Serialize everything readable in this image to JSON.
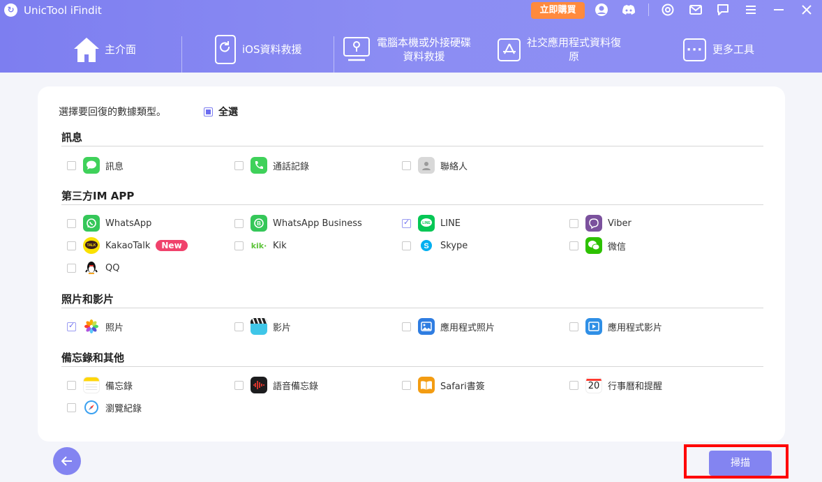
{
  "app": {
    "title": "UnicTool iFindit",
    "buy_label": "立即購買"
  },
  "titlebar_icons": [
    "user-avatar-icon",
    "discord-icon",
    "settings-icon",
    "mail-icon",
    "chat-icon",
    "menu-icon",
    "minimize-icon",
    "close-icon"
  ],
  "nav": {
    "home": "主介面",
    "ios": "iOS資料救援",
    "pc_line1": "電腦本機或外接硬碟",
    "pc_line2": "資料救援",
    "social_line1": "社交應用程式資料復",
    "social_line2": "原",
    "more": "更多工具"
  },
  "prompt": "選擇要回復的數據類型。",
  "select_all": "全選",
  "sections": {
    "messages": "訊息",
    "im": "第三方IM APP",
    "photos": "照片和影片",
    "notes": "備忘錄和其他"
  },
  "items": {
    "sms": "訊息",
    "calls": "通話記錄",
    "contacts": "聯絡人",
    "whatsapp": "WhatsApp",
    "whatsapp_business": "WhatsApp Business",
    "line": "LINE",
    "viber": "Viber",
    "kakaotalk": "KakaoTalk",
    "kakao_badge": "New",
    "kik": "Kik",
    "skype": "Skype",
    "wechat": "微信",
    "qq": "QQ",
    "photos": "照片",
    "videos": "影片",
    "app_photos": "應用程式照片",
    "app_videos": "應用程式影片",
    "notes": "備忘錄",
    "voice_memos": "語音備忘錄",
    "safari_bookmarks": "Safari書簽",
    "calendar": "行事曆和提醒",
    "calendar_day": "20",
    "history": "瀏覽紀錄"
  },
  "checked": {
    "line": true,
    "photos": true
  },
  "scan_label": "掃描",
  "colors": {
    "accent": "#7d7ef0",
    "buy": "#ff8a3d",
    "highlight": "#ff0000"
  }
}
